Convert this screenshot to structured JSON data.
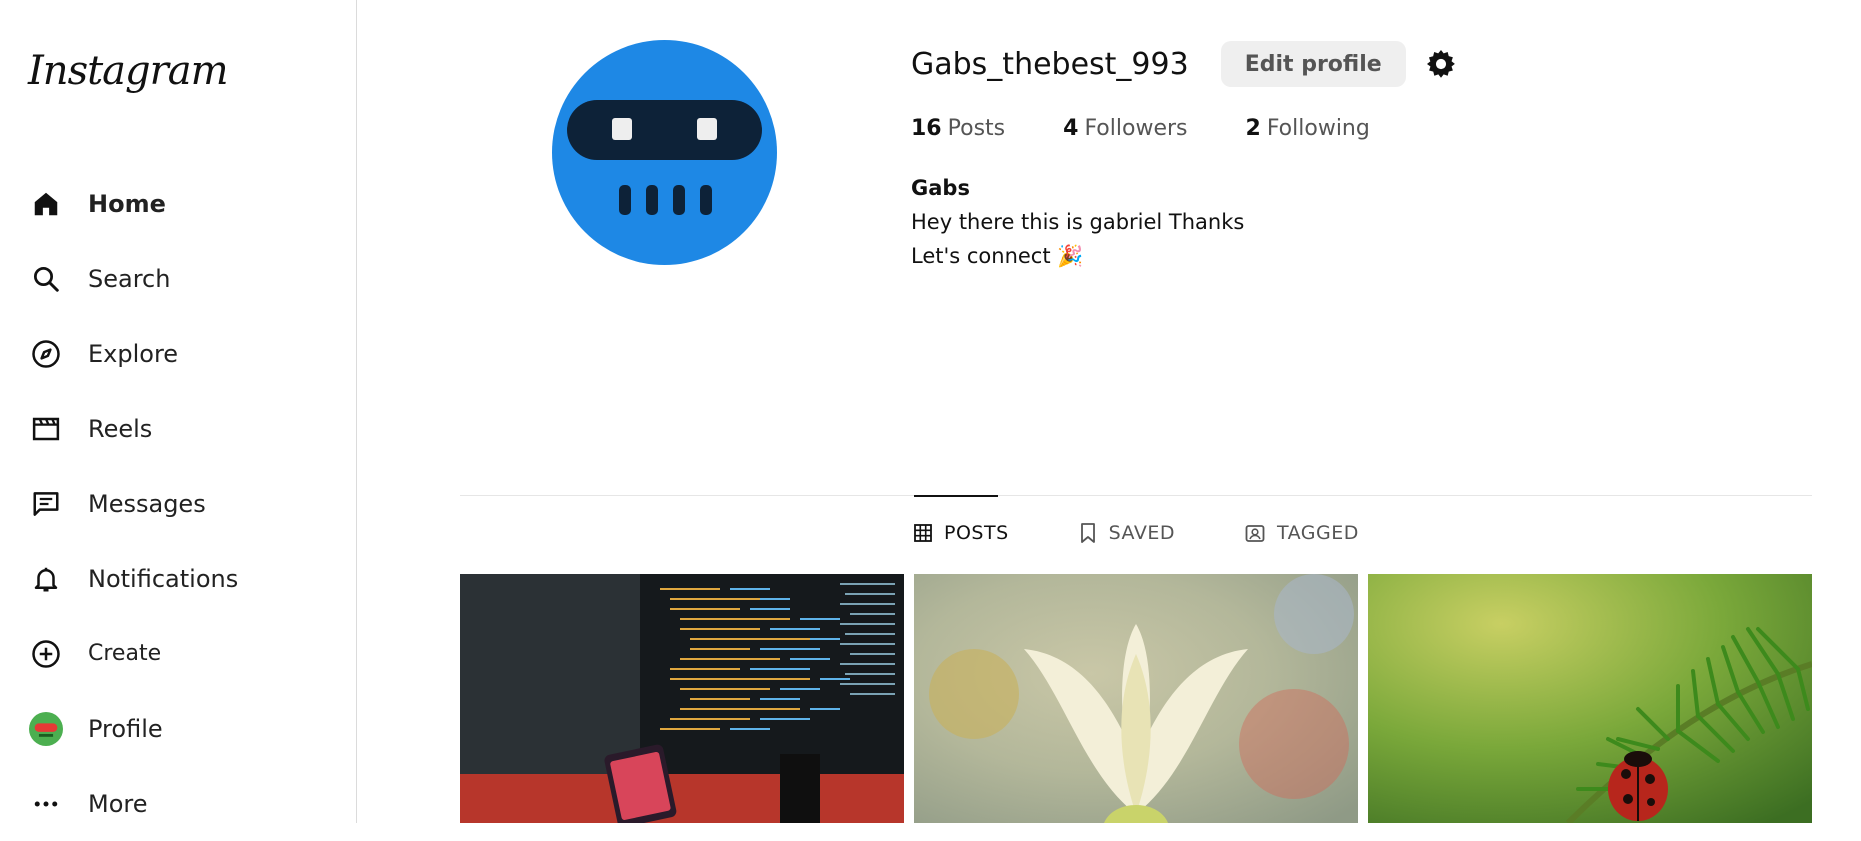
{
  "sidebar": {
    "logo": "Instagram",
    "items": [
      {
        "label": "Home",
        "icon": "home-icon",
        "active": true
      },
      {
        "label": "Search",
        "icon": "search-icon"
      },
      {
        "label": "Explore",
        "icon": "compass-icon"
      },
      {
        "label": "Reels",
        "icon": "reels-icon"
      },
      {
        "label": "Messages",
        "icon": "message-icon"
      },
      {
        "label": "Notifications",
        "icon": "bell-icon"
      },
      {
        "label": "Create",
        "icon": "plus-circle-icon"
      },
      {
        "label": "Profile",
        "icon": "profile-avatar-icon"
      },
      {
        "label": "More",
        "icon": "more-dots-icon"
      }
    ]
  },
  "profile": {
    "username": "Gabs_thebest_993",
    "edit_label": "Edit profile",
    "posts_count": "16",
    "posts_label": "Posts",
    "followers_count": "4",
    "followers_label": "Followers",
    "following_count": "2",
    "following_label": "Following",
    "display_name": "Gabs",
    "bio_line1": "Hey there this is gabriel Thanks",
    "bio_line2": "Let's connect 🎉"
  },
  "tabs": [
    {
      "label": "POSTS",
      "icon": "grid-icon",
      "active": true
    },
    {
      "label": "SAVED",
      "icon": "bookmark-icon"
    },
    {
      "label": "TAGGED",
      "icon": "tagged-icon"
    }
  ],
  "posts": [
    {
      "subject": "code-on-monitors"
    },
    {
      "subject": "white-tulip"
    },
    {
      "subject": "ladybug-on-branch"
    }
  ],
  "colors": {
    "avatar_bg": "#1e88e5",
    "accent": "#111111"
  }
}
